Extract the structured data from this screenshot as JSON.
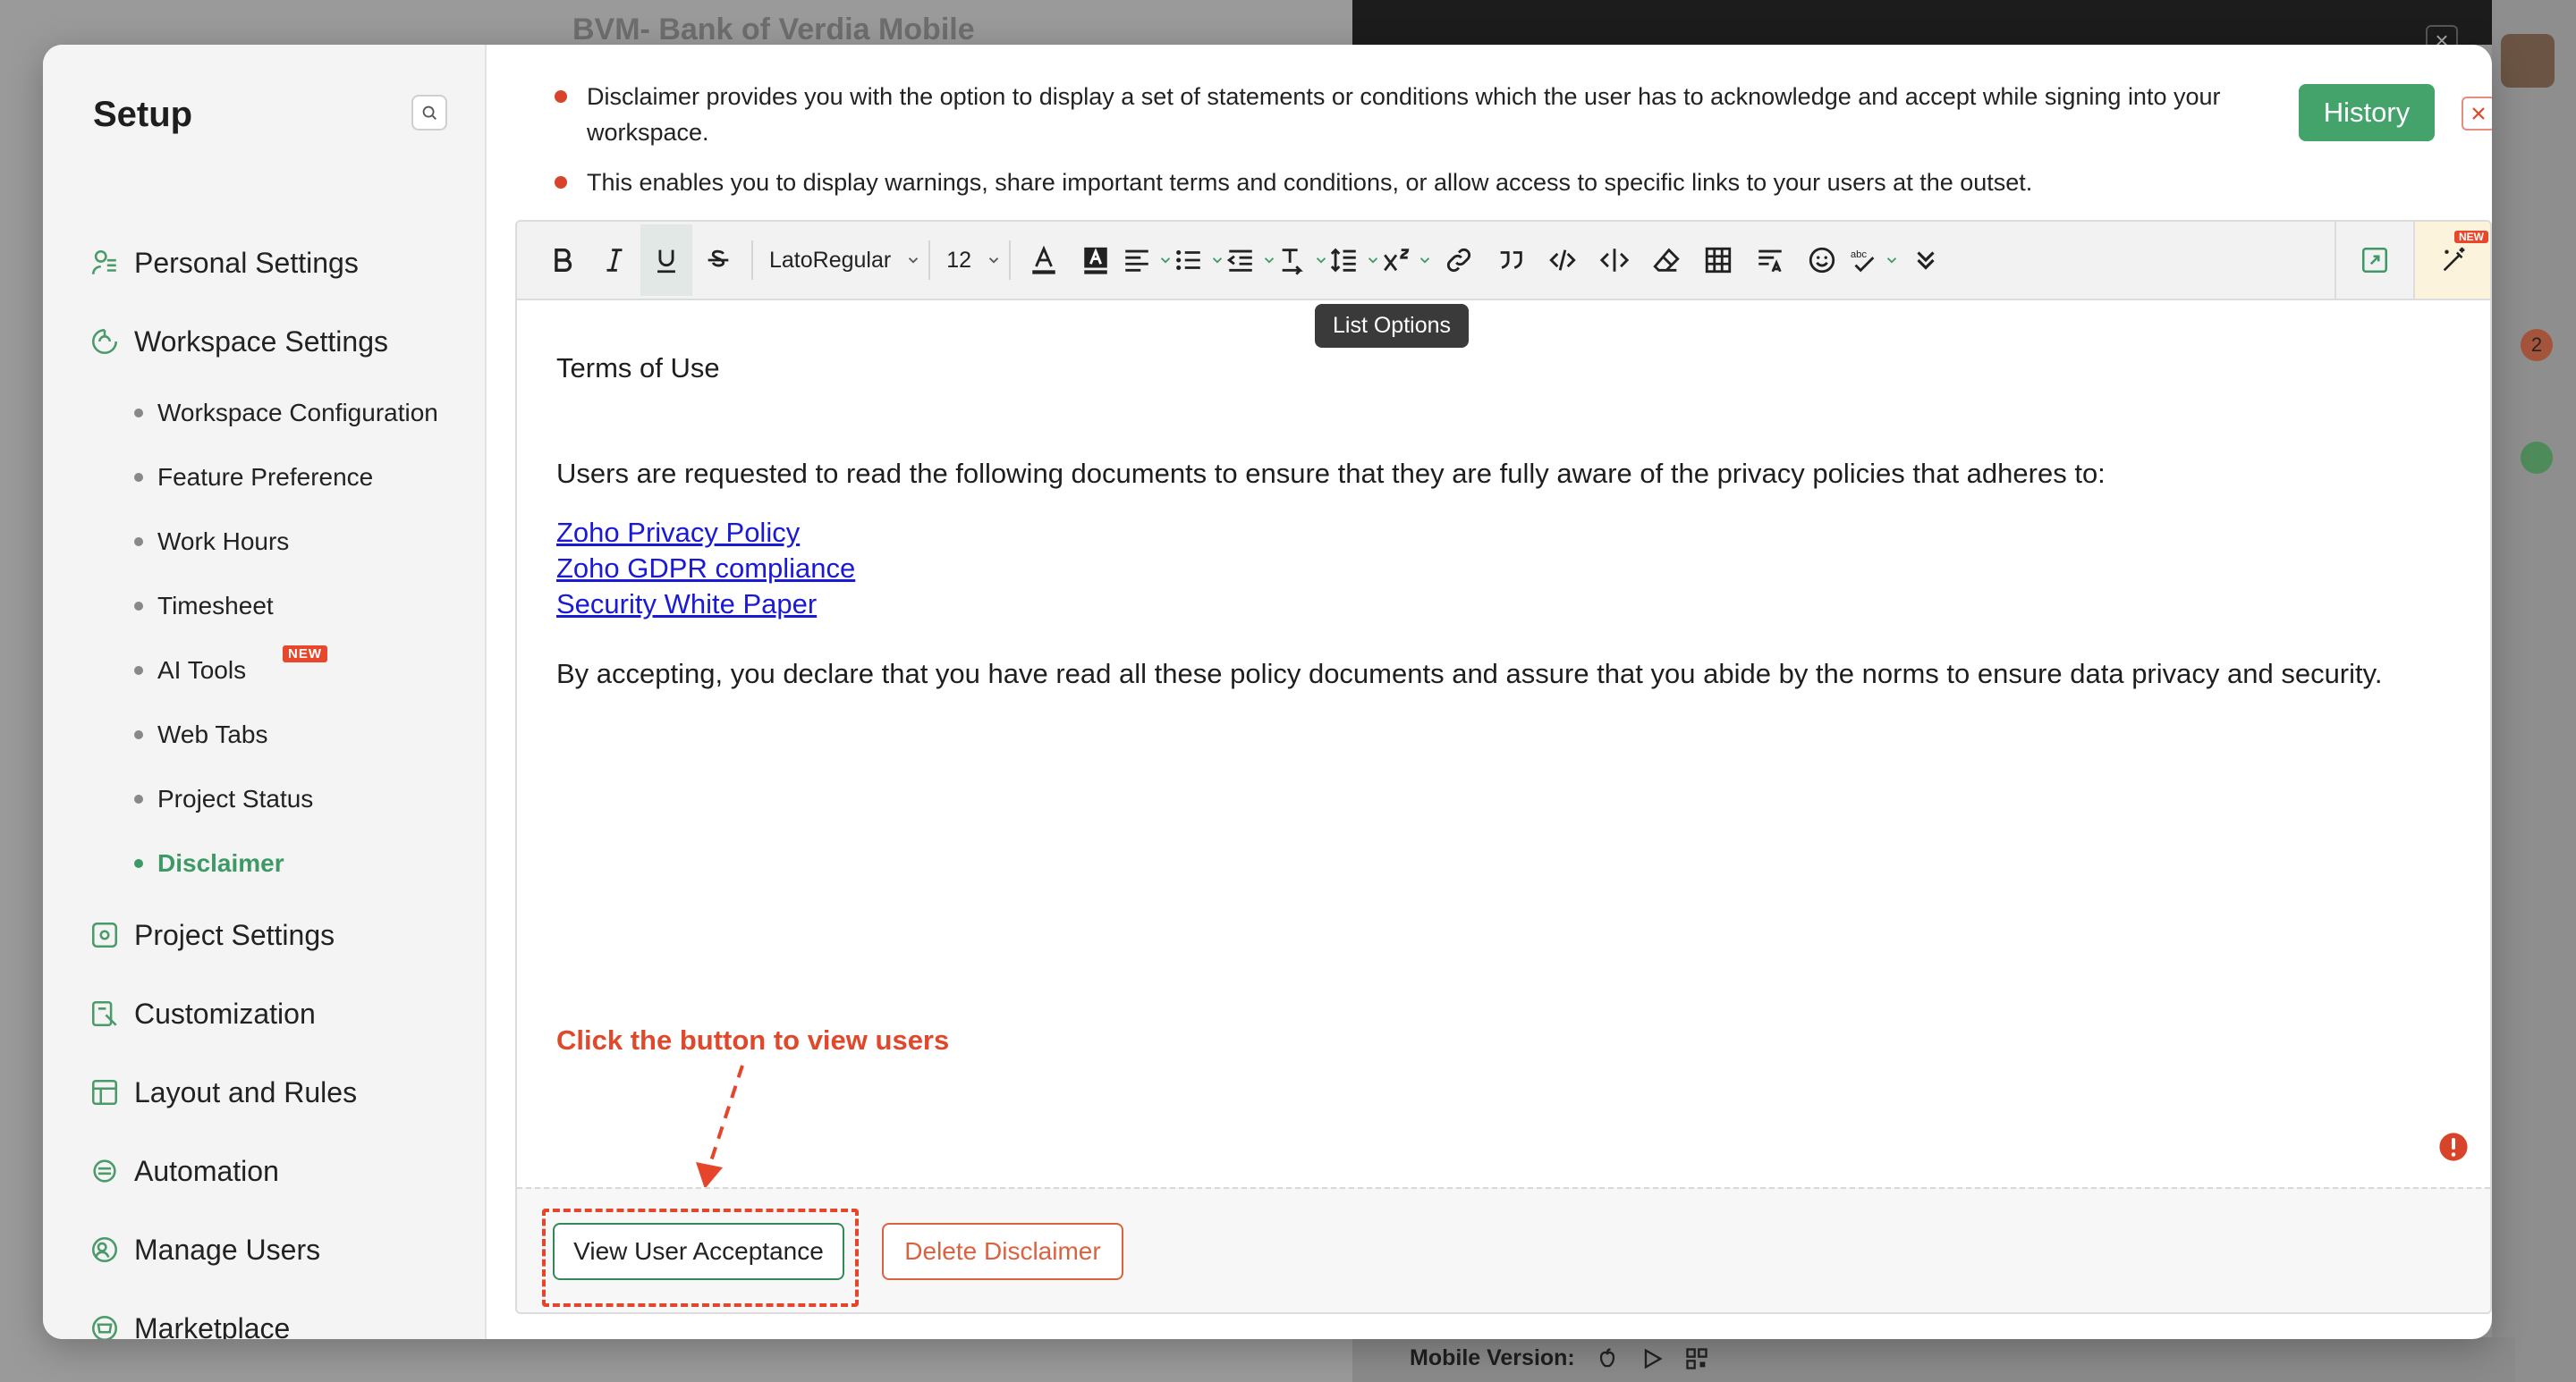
{
  "background": {
    "project_title": "BVM- Bank of Verdia Mobile",
    "mobile_label": "Mobile Version:",
    "badge_count": "2"
  },
  "sidebar": {
    "title": "Setup",
    "items": [
      {
        "label": "Personal Settings",
        "icon": "person-settings-icon"
      },
      {
        "label": "Workspace Settings",
        "icon": "workspace-icon"
      }
    ],
    "sub_items": [
      {
        "label": "Workspace Configuration"
      },
      {
        "label": "Feature Preference"
      },
      {
        "label": "Work Hours"
      },
      {
        "label": "Timesheet"
      },
      {
        "label": "AI Tools",
        "tag": "NEW"
      },
      {
        "label": "Web Tabs"
      },
      {
        "label": "Project Status"
      },
      {
        "label": "Disclaimer"
      }
    ],
    "more_items": [
      {
        "label": "Project Settings"
      },
      {
        "label": "Customization"
      },
      {
        "label": "Layout and Rules"
      },
      {
        "label": "Automation"
      },
      {
        "label": "Manage Users"
      },
      {
        "label": "Marketplace"
      }
    ]
  },
  "info": {
    "line1": "Disclaimer provides you with the option to display a set of statements or conditions which the user has to acknowledge and accept while signing into your workspace.",
    "line2": "This enables you to display warnings, share important terms and conditions, or allow access to specific links to your users at the outset."
  },
  "header": {
    "history_label": "History"
  },
  "toolbar": {
    "font_name": "LatoRegular",
    "font_size": "12",
    "tooltip": "List Options",
    "new_tag": "NEW"
  },
  "editor": {
    "heading": "Terms of Use",
    "intro": "Users are requested to read the following documents to ensure that they are fully aware of the privacy policies that adheres to:",
    "links": [
      "Zoho Privacy Policy",
      "Zoho GDPR compliance",
      "Security White Paper"
    ],
    "closing": "By accepting, you declare that you have read all these policy documents and assure that you abide by the norms to ensure data privacy and security."
  },
  "annotation": {
    "text": "Click the button to view users"
  },
  "footer": {
    "view_label": "View User Acceptance",
    "delete_label": "Delete Disclaimer"
  },
  "colors": {
    "accent_green": "#44a36b",
    "alert_red": "#e0482c",
    "link_blue": "#1a1ad6"
  }
}
